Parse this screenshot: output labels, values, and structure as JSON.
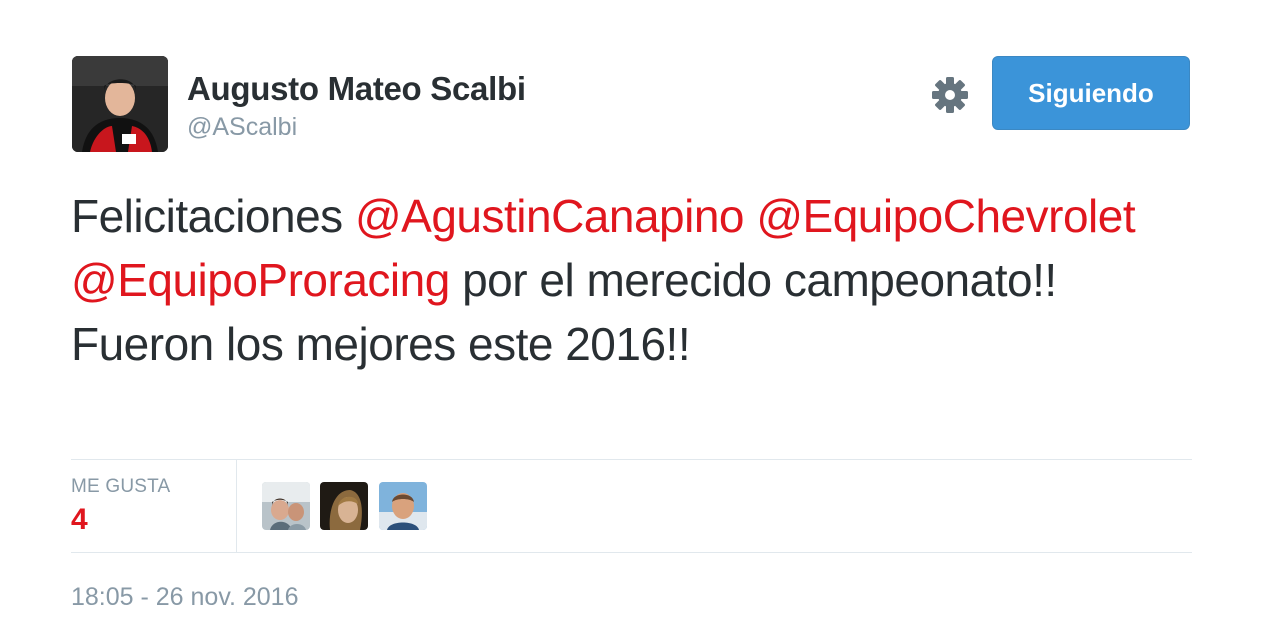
{
  "user": {
    "display_name": "Augusto Mateo Scalbi",
    "username": "@AScalbi",
    "avatar": "profile-photo"
  },
  "actions": {
    "settings_icon": "gear-icon",
    "follow_label": "Siguiendo"
  },
  "tweet": {
    "text_start": "Felicitaciones ",
    "mention_1": "@AgustinCanapino",
    "space_1": " ",
    "mention_2": "@EquipoChevrolet",
    "space_2": " ",
    "mention_3": "@EquipoProracing",
    "text_end": " por el merecido campeonato!! Fueron los mejores este 2016!!"
  },
  "stats": {
    "likes_label": "ME GUSTA",
    "likes_count": "4",
    "likers": [
      "liker-avatar-1",
      "liker-avatar-2",
      "liker-avatar-3"
    ]
  },
  "timestamp": "18:05 - 26 nov. 2016",
  "colors": {
    "accent": "#e0161e",
    "button": "#3b94d9",
    "muted": "#8899a6",
    "text": "#292f33"
  }
}
